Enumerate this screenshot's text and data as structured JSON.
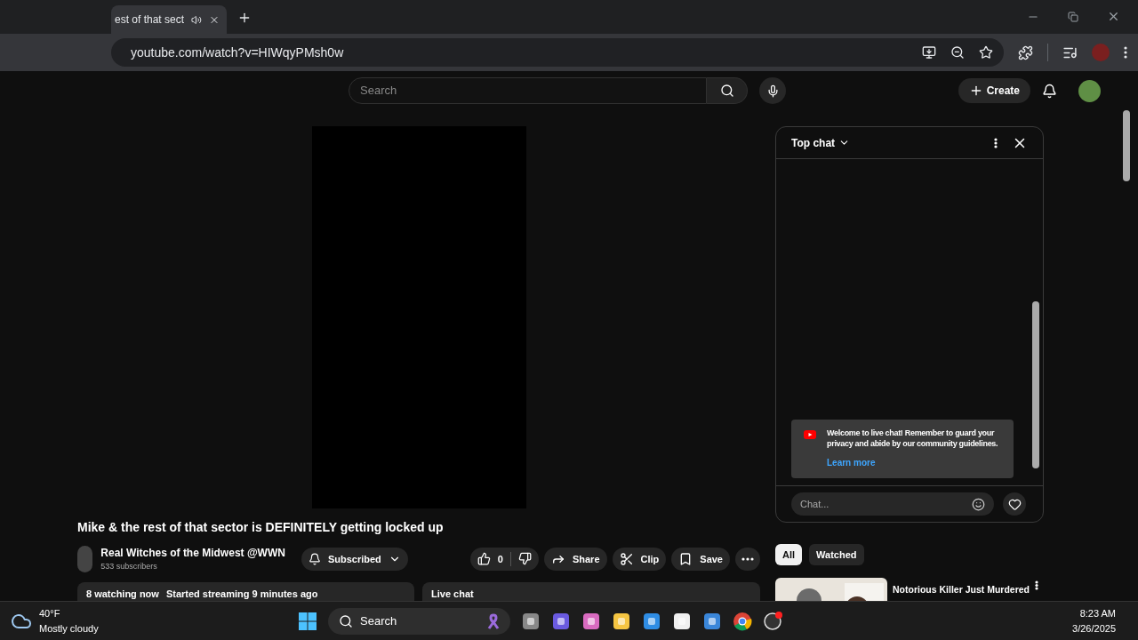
{
  "browser": {
    "tab": {
      "title": "est of that sect",
      "audio": true
    },
    "address": "youtube.com/watch?v=HIWqyPMsh0w"
  },
  "header": {
    "search_placeholder": "Search",
    "create": "Create"
  },
  "video": {
    "title": "Mike & the rest of that sector is DEFINITELY getting locked up",
    "channel": "Real Witches of the Midwest @WWN",
    "subscribers": "533 subscribers",
    "subscribe_label": "Subscribed",
    "likes": "0",
    "actions": [
      {
        "kind": "share",
        "label": "Share"
      },
      {
        "kind": "clip",
        "label": "Clip"
      },
      {
        "kind": "save",
        "label": "Save"
      }
    ]
  },
  "info": {
    "watching": "8 watching now",
    "started": "Started streaming 9 minutes ago",
    "live_chat": "Live chat"
  },
  "chat": {
    "mode": "Top chat",
    "welcome": "Welcome to live chat! Remember to guard your privacy and abide by our community guidelines.",
    "learn_more": "Learn more",
    "placeholder": "Chat..."
  },
  "chips": [
    {
      "label": "All",
      "selected": true
    },
    {
      "label": "Watched",
      "selected": false
    }
  ],
  "suggestion": {
    "title": "Notorious Killer Just Murdered"
  },
  "taskbar": {
    "temperature": "40°F",
    "weather": "Mostly cloudy",
    "search_placeholder": "Search",
    "time": "8:23 AM",
    "date": "3/26/2025"
  }
}
